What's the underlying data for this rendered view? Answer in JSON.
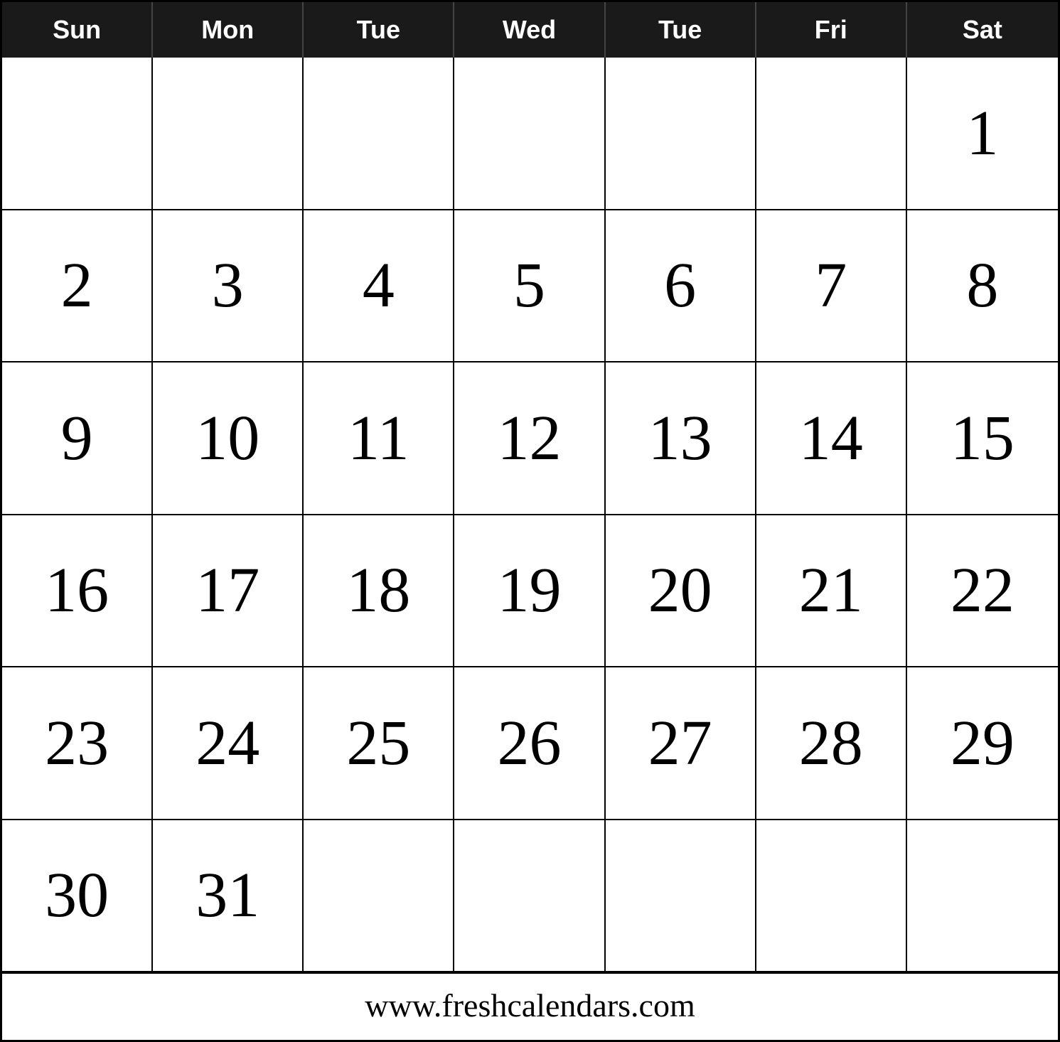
{
  "calendar": {
    "header": {
      "days": [
        "Sun",
        "Mon",
        "Tue",
        "Wed",
        "Tue",
        "Fri",
        "Sat"
      ]
    },
    "weeks": [
      [
        "",
        "",
        "",
        "",
        "",
        "",
        "1"
      ],
      [
        "2",
        "3",
        "4",
        "5",
        "6",
        "7",
        "8"
      ],
      [
        "9",
        "10",
        "11",
        "12",
        "13",
        "14",
        "15"
      ],
      [
        "16",
        "17",
        "18",
        "19",
        "20",
        "21",
        "22"
      ],
      [
        "23",
        "24",
        "25",
        "26",
        "27",
        "28",
        "29"
      ],
      [
        "30",
        "31",
        "",
        "",
        "",
        "",
        ""
      ]
    ],
    "footer": {
      "url": "www.freshcalendars.com"
    }
  }
}
